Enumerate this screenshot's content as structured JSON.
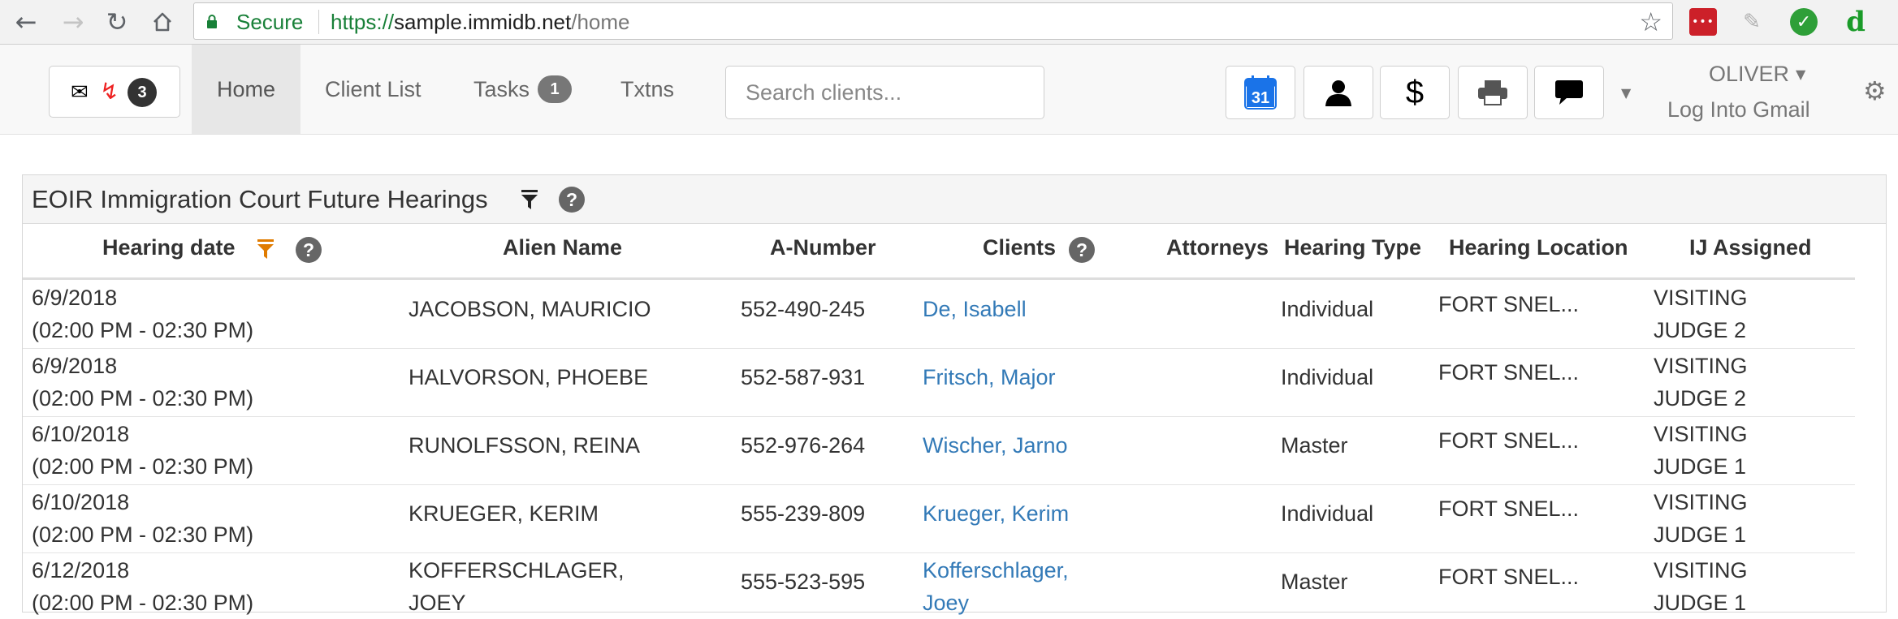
{
  "browser": {
    "secure_label": "Secure",
    "url_scheme": "https://",
    "url_host": "sample.immidb.net",
    "url_path": "/home"
  },
  "navbar": {
    "notifications_count": "3",
    "items": {
      "home": "Home",
      "client_list": "Client List",
      "tasks": "Tasks",
      "txtns": "Txtns"
    },
    "tasks_count": "1",
    "search_placeholder": "Search clients...",
    "calendar_day": "31",
    "dollar_symbol": "$",
    "user_name": "OLIVER",
    "gmail_link": "Log Into Gmail"
  },
  "panel": {
    "title": "EOIR Immigration Court Future Hearings",
    "columns": {
      "hearing_date": "Hearing date",
      "alien_name": "Alien Name",
      "a_number": "A-Number",
      "clients": "Clients",
      "attorneys": "Attorneys",
      "hearing_type": "Hearing Type",
      "hearing_location": "Hearing Location",
      "ij_assigned": "IJ Assigned"
    },
    "rows": [
      {
        "date": "6/9/2018",
        "time": "(02:00 PM - 02:30 PM)",
        "alien": "JACOBSON, MAURICIO",
        "alien2": "",
        "anum": "552-490-245",
        "client": "De, Isabell",
        "client2": "",
        "type": "Individual",
        "location": "FORT SNEL...",
        "ij1": "VISITING",
        "ij2": "JUDGE 2"
      },
      {
        "date": "6/9/2018",
        "time": "(02:00 PM - 02:30 PM)",
        "alien": "HALVORSON, PHOEBE",
        "alien2": "",
        "anum": "552-587-931",
        "client": "Fritsch, Major",
        "client2": "",
        "type": "Individual",
        "location": "FORT SNEL...",
        "ij1": "VISITING",
        "ij2": "JUDGE 2"
      },
      {
        "date": "6/10/2018",
        "time": "(02:00 PM - 02:30 PM)",
        "alien": "RUNOLFSSON, REINA",
        "alien2": "",
        "anum": "552-976-264",
        "client": "Wischer, Jarno",
        "client2": "",
        "type": "Master",
        "location": "FORT SNEL...",
        "ij1": "VISITING",
        "ij2": "JUDGE 1"
      },
      {
        "date": "6/10/2018",
        "time": "(02:00 PM - 02:30 PM)",
        "alien": "KRUEGER, KERIM",
        "alien2": "",
        "anum": "555-239-809",
        "client": "Krueger, Kerim",
        "client2": "",
        "type": "Individual",
        "location": "FORT SNEL...",
        "ij1": "VISITING",
        "ij2": "JUDGE 1"
      },
      {
        "date": "6/12/2018",
        "time": "(02:00 PM - 02:30 PM)",
        "alien": "KOFFERSCHLAGER,",
        "alien2": "JOEY",
        "anum": "555-523-595",
        "client": "Kofferschlager,",
        "client2": "Joey",
        "type": "Master",
        "location": "FORT SNEL...",
        "ij1": "VISITING",
        "ij2": "JUDGE 1"
      }
    ]
  }
}
